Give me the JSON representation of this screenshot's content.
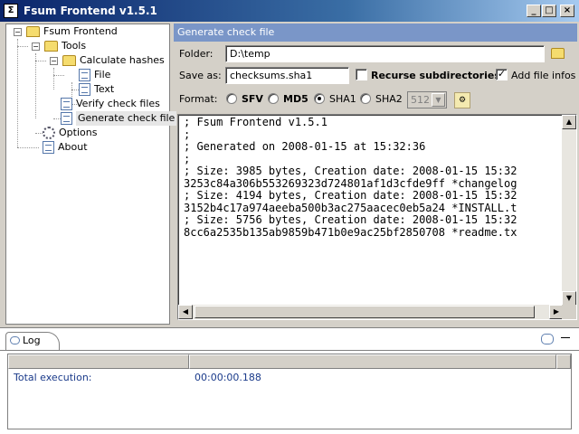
{
  "window": {
    "title": "Fsum Frontend v1.5.1",
    "min": "_",
    "max": "□",
    "close": "×"
  },
  "tree": {
    "root": "Fsum Frontend",
    "tools": "Tools",
    "calculate": "Calculate hashes",
    "file": "File",
    "text": "Text",
    "verify": "Verify check files",
    "generate": "Generate check file",
    "options": "Options",
    "about": "About",
    "expand_minus": "−"
  },
  "panel": {
    "header": "Generate check file",
    "folder_label": "Folder:",
    "folder_value": "D:\\temp",
    "saveas_label": "Save as:",
    "saveas_value": "checksums.sha1",
    "recurse_label": "Recurse subdirectories",
    "recurse_checked": false,
    "addinfo_label": "Add file infos",
    "addinfo_checked": true,
    "format_label": "Format:",
    "formats": [
      "SFV",
      "MD5",
      "SHA1",
      "SHA2"
    ],
    "selected_format": "SHA1",
    "sha2_bits": "512",
    "output_lines": [
      "; Fsum Frontend v1.5.1",
      ";",
      "; Generated on 2008-01-15 at 15:32:36",
      ";",
      "; Size: 3985 bytes, Creation date: 2008-01-15 15:32",
      "3253c84a306b553269323d724801af1d3cfde9ff *changelog",
      "; Size: 4194 bytes, Creation date: 2008-01-15 15:32",
      "3152b4c17a974aeeba500b3ac275aacec0eb5a24 *INSTALL.t",
      "; Size: 5756 bytes, Creation date: 2008-01-15 15:32",
      "8cc6a2535b135ab9859b471b0e9ac25bf2850708 *readme.tx"
    ]
  },
  "log": {
    "tab": "Log",
    "rows": [
      {
        "label": "Total execution:",
        "value": "00:00:00.188"
      }
    ]
  }
}
